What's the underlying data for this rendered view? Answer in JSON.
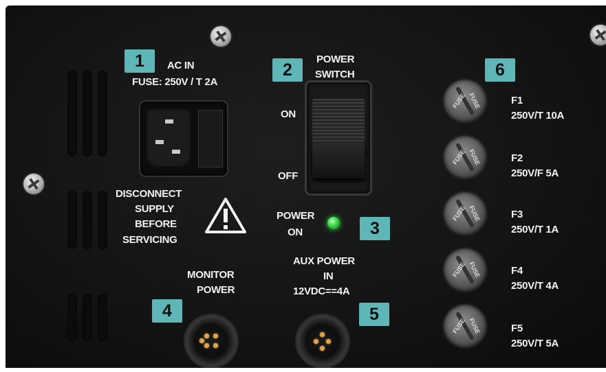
{
  "labels": {
    "ac_in": "AC IN",
    "fuse_rating": "FUSE: 250V / T 2A",
    "power_switch": [
      "POWER",
      "SWITCH"
    ],
    "on": "ON",
    "off": "OFF",
    "power_on": [
      "POWER",
      "ON"
    ],
    "warning": [
      "DISCONNECT",
      "SUPPLY",
      "BEFORE",
      "SERVICING"
    ],
    "monitor_power": [
      "MONITOR",
      "POWER"
    ],
    "aux_power": [
      "AUX POWER",
      "IN",
      "12VDC==4A"
    ]
  },
  "badges": [
    "1",
    "2",
    "3",
    "4",
    "5",
    "6"
  ],
  "fuses": [
    {
      "name": "F1",
      "rating": "250V/T 10A"
    },
    {
      "name": "F2",
      "rating": "250V/F 5A"
    },
    {
      "name": "F3",
      "rating": "250V/T 1A"
    },
    {
      "name": "F4",
      "rating": "250V/T 4A"
    },
    {
      "name": "F5",
      "rating": "250V/T 5A"
    }
  ],
  "fuse_cap_text": "FUSE",
  "colors": {
    "badge": "#5fb6b6",
    "panel": "#141414",
    "led": "#3fdc4a",
    "pin": "#e0a24a"
  }
}
